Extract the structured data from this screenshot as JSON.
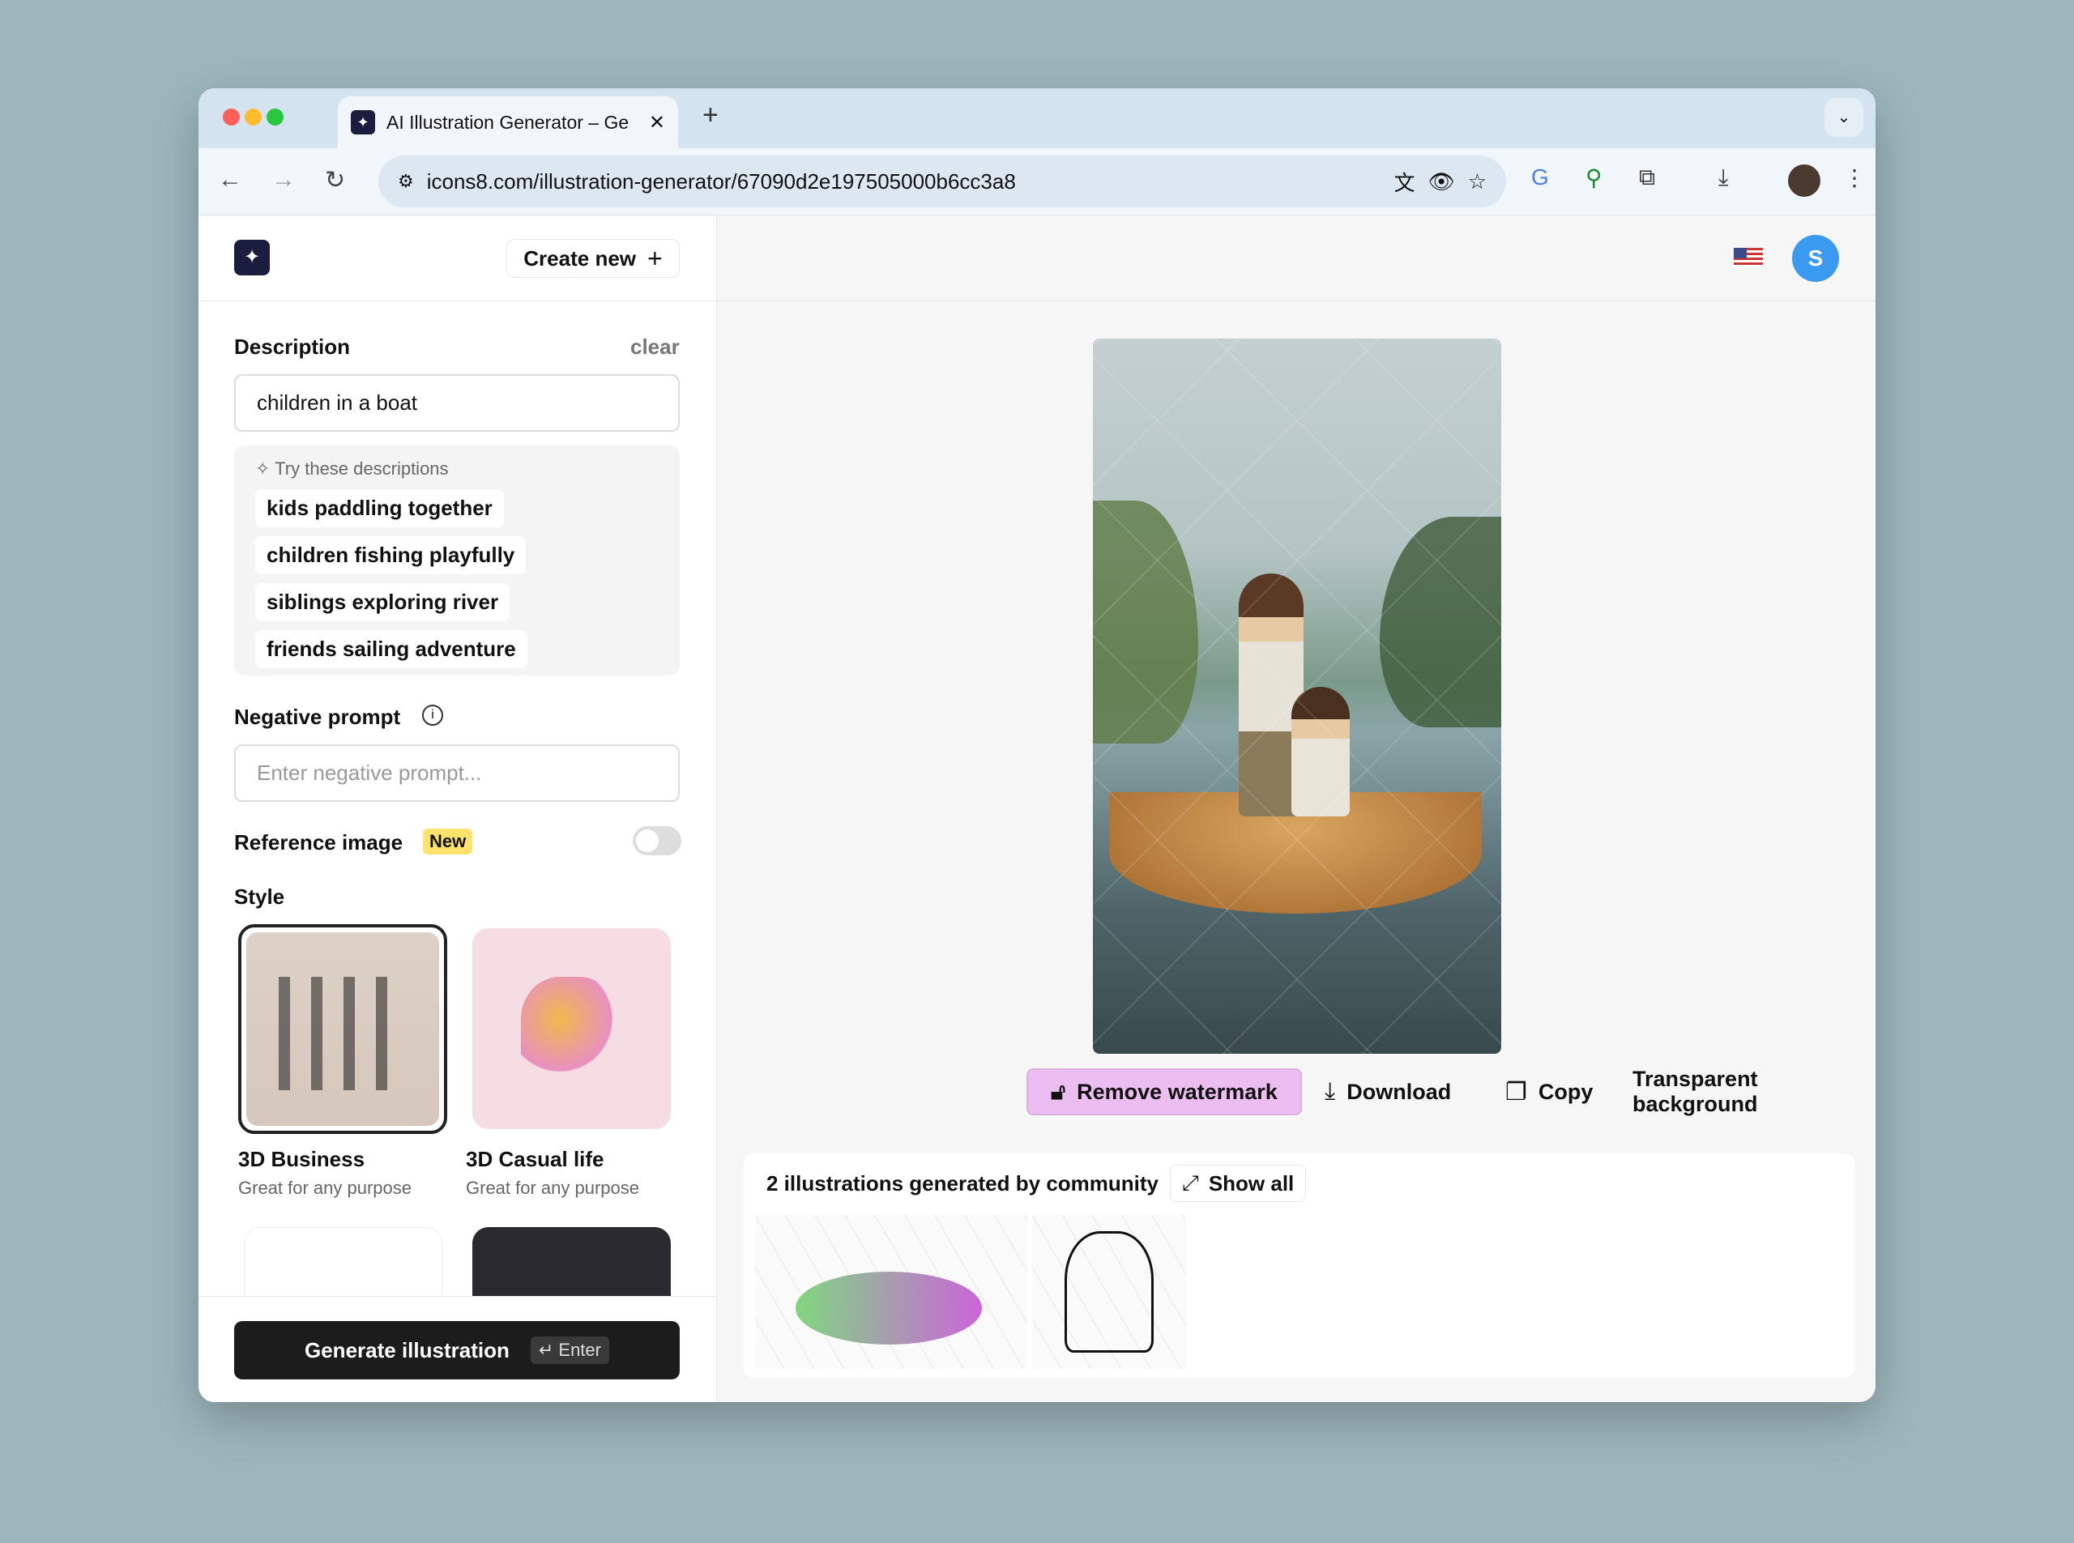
{
  "browser": {
    "tab_title": "AI Illustration Generator – Ge",
    "url": "icons8.com/illustration-generator/67090d2e197505000b6cc3a8"
  },
  "header": {
    "create_new": "Create new",
    "avatar_initial": "S"
  },
  "sidebar": {
    "description_label": "Description",
    "clear": "clear",
    "description_value": "children in a boat",
    "suggestions_title": "Try these descriptions",
    "suggestions": [
      "kids paddling together",
      "children fishing playfully",
      "siblings exploring river",
      "friends sailing adventure"
    ],
    "negative_label": "Negative prompt",
    "negative_placeholder": "Enter negative prompt...",
    "reference_label": "Reference image",
    "reference_badge": "New",
    "reference_enabled": false,
    "style_label": "Style",
    "styles": [
      {
        "name": "3D Business",
        "desc": "Great for any purpose",
        "selected": true
      },
      {
        "name": "3D Casual life",
        "desc": "Great for any purpose",
        "selected": false
      }
    ],
    "generate": "Generate illustration",
    "generate_key": "Enter"
  },
  "main": {
    "remove_watermark": "Remove watermark",
    "download": "Download",
    "copy": "Copy",
    "transparent_bg": "Transparent background",
    "transparent_enabled": false,
    "community_title": "2 illustrations generated by community",
    "show_all": "Show all"
  },
  "colors": {
    "accent_pink": "#ebbdf0",
    "avatar": "#3a9af0",
    "badge": "#fde36b"
  }
}
